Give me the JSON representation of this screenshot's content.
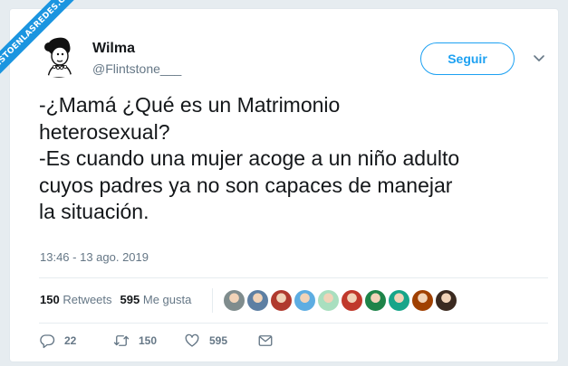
{
  "watermark": "VISTOENLASREDES.COM",
  "user": {
    "name": "Wilma",
    "handle": "@Flintstone___"
  },
  "follow_label": "Seguir",
  "tweet": {
    "text": "-¿Mamá ¿Qué es un Matrimonio\nheterosexual?\n-Es cuando una mujer acoge a un niño adulto\ncuyos padres ya no son capaces de manejar\nla situación.",
    "timestamp": "13:46 - 13 ago. 2019"
  },
  "stats": {
    "retweets_count": "150",
    "retweets_label": "Retweets",
    "likes_count": "595",
    "likes_label": "Me gusta"
  },
  "likers": [
    {
      "color": "#7f8c8d"
    },
    {
      "color": "#5d7fa3"
    },
    {
      "color": "#b03a2e"
    },
    {
      "color": "#5dade2"
    },
    {
      "color": "#a9dfbf"
    },
    {
      "color": "#c0392b"
    },
    {
      "color": "#1e8449"
    },
    {
      "color": "#17a589"
    },
    {
      "color": "#a04000"
    },
    {
      "color": "#3b2a20"
    }
  ],
  "actions": {
    "replies": "22",
    "retweets": "150",
    "likes": "595"
  },
  "colors": {
    "accent": "#1da1f2",
    "text": "#14171a",
    "muted": "#657786"
  }
}
